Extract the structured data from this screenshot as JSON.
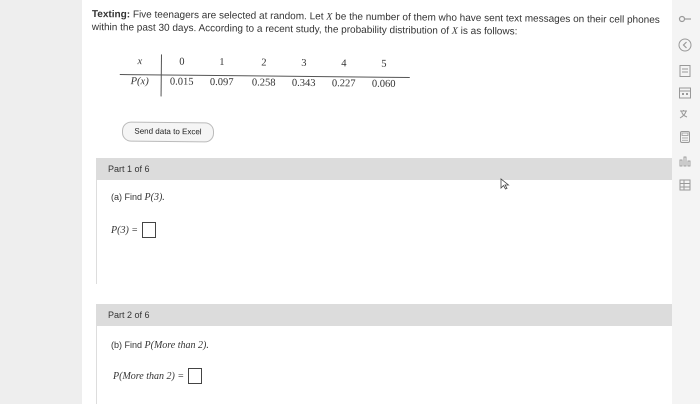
{
  "problem": {
    "title": "Texting:",
    "line1_a": " Five teenagers are selected at random. Let ",
    "line1_var": "X",
    "line1_b": " be the number of them who have sent text messages on their cell phones",
    "line2_a": "within the past 30 days. According to a recent study, the probability distribution of ",
    "line2_var": "X",
    "line2_b": " is as follows:"
  },
  "table": {
    "x_label": "x",
    "p_label": "P(x)",
    "x_values": [
      "0",
      "1",
      "2",
      "3",
      "4",
      "5"
    ],
    "p_values": [
      "0.015",
      "0.097",
      "0.258",
      "0.343",
      "0.227",
      "0.060"
    ]
  },
  "excel_button": "Send data to Excel",
  "part1": {
    "header": "Part 1 of 6",
    "question_prefix": "(a) Find ",
    "question_expr": "P(3).",
    "answer_label": "P(3) ="
  },
  "part2": {
    "header": "Part 2 of 6",
    "question_prefix": "(b) Find ",
    "question_expr": "P(More than 2).",
    "answer_label": "P(More than 2) ="
  },
  "icons": {
    "colors": {
      "sidebar": "#f4f4f4",
      "header": "#dcdcdc",
      "icon": "#888888"
    }
  }
}
